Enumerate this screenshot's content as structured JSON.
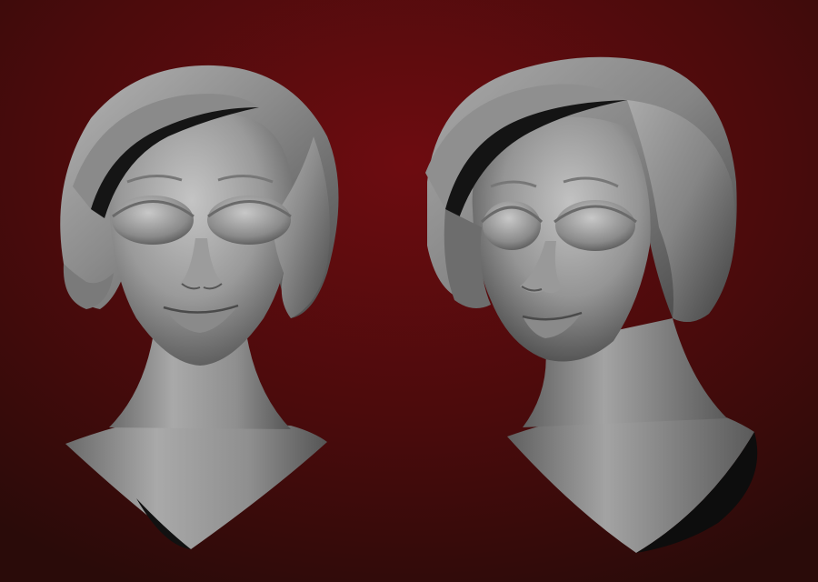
{
  "scene": {
    "colors": {
      "background_top": "#6a0a0e",
      "background_mid": "#4a0b0c",
      "background_bottom": "#2a0b09",
      "clay_light": "#bdbdbd",
      "clay_mid": "#8e8e8e",
      "clay_dark": "#3a3a3a",
      "shadow": "#0a0a0a"
    },
    "subjects": [
      {
        "name": "sculpted-bust-front-view"
      },
      {
        "name": "sculpted-bust-three-quarter-view"
      }
    ]
  }
}
